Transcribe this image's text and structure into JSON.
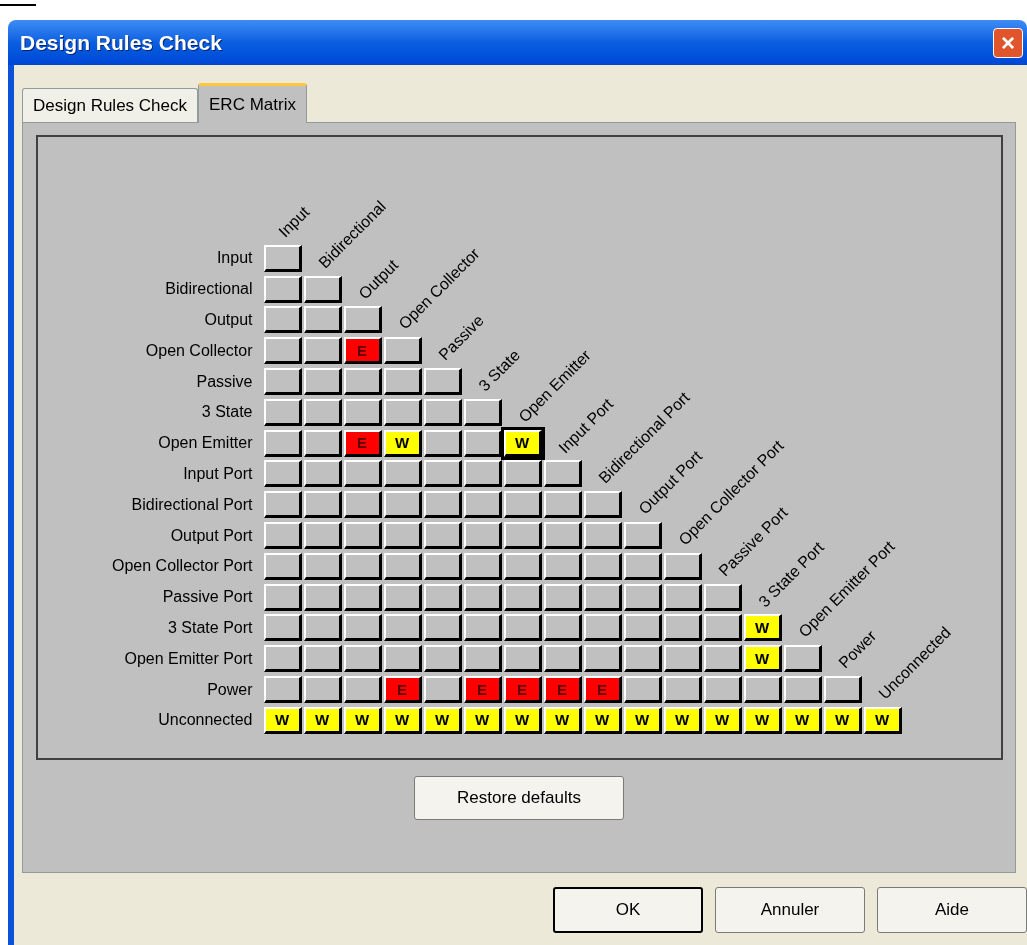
{
  "window": {
    "title": "Design Rules Check",
    "close": "×"
  },
  "tabs": [
    {
      "label": "Design Rules Check",
      "selected": false
    },
    {
      "label": "ERC Matrix",
      "selected": true
    }
  ],
  "matrix": {
    "pin_types": [
      {
        "label": "Input",
        "cells": [
          {
            "kind": "none",
            "selected": false
          }
        ]
      },
      {
        "label": "Bidirectional",
        "cells": [
          {
            "kind": "none",
            "selected": false
          },
          {
            "kind": "none",
            "selected": false
          }
        ]
      },
      {
        "label": "Output",
        "cells": [
          {
            "kind": "none",
            "selected": false
          },
          {
            "kind": "none",
            "selected": false
          },
          {
            "kind": "none",
            "selected": false
          }
        ]
      },
      {
        "label": "Open Collector",
        "cells": [
          {
            "kind": "none",
            "selected": false
          },
          {
            "kind": "none",
            "selected": false
          },
          {
            "kind": "error",
            "text": "E",
            "selected": false
          },
          {
            "kind": "none",
            "selected": false
          }
        ]
      },
      {
        "label": "Passive",
        "cells": [
          {
            "kind": "none",
            "selected": false
          },
          {
            "kind": "none",
            "selected": false
          },
          {
            "kind": "none",
            "selected": false
          },
          {
            "kind": "none",
            "selected": false
          },
          {
            "kind": "none",
            "selected": false
          }
        ]
      },
      {
        "label": "3 State",
        "cells": [
          {
            "kind": "none",
            "selected": false
          },
          {
            "kind": "none",
            "selected": false
          },
          {
            "kind": "none",
            "selected": false
          },
          {
            "kind": "none",
            "selected": false
          },
          {
            "kind": "none",
            "selected": false
          },
          {
            "kind": "none",
            "selected": false
          }
        ]
      },
      {
        "label": "Open Emitter",
        "cells": [
          {
            "kind": "none",
            "selected": false
          },
          {
            "kind": "none",
            "selected": false
          },
          {
            "kind": "error",
            "text": "E",
            "selected": false
          },
          {
            "kind": "warning",
            "text": "W",
            "selected": false
          },
          {
            "kind": "none",
            "selected": false
          },
          {
            "kind": "none",
            "selected": false
          },
          {
            "kind": "warning",
            "text": "W",
            "selected": true
          }
        ]
      },
      {
        "label": "Input Port",
        "cells": [
          {
            "kind": "none",
            "selected": false
          },
          {
            "kind": "none",
            "selected": false
          },
          {
            "kind": "none",
            "selected": false
          },
          {
            "kind": "none",
            "selected": false
          },
          {
            "kind": "none",
            "selected": false
          },
          {
            "kind": "none",
            "selected": false
          },
          {
            "kind": "none",
            "selected": false
          },
          {
            "kind": "none",
            "selected": false
          }
        ]
      },
      {
        "label": "Bidirectional Port",
        "cells": [
          {
            "kind": "none",
            "selected": false
          },
          {
            "kind": "none",
            "selected": false
          },
          {
            "kind": "none",
            "selected": false
          },
          {
            "kind": "none",
            "selected": false
          },
          {
            "kind": "none",
            "selected": false
          },
          {
            "kind": "none",
            "selected": false
          },
          {
            "kind": "none",
            "selected": false
          },
          {
            "kind": "none",
            "selected": false
          },
          {
            "kind": "none",
            "selected": false
          }
        ]
      },
      {
        "label": "Output Port",
        "cells": [
          {
            "kind": "none",
            "selected": false
          },
          {
            "kind": "none",
            "selected": false
          },
          {
            "kind": "none",
            "selected": false
          },
          {
            "kind": "none",
            "selected": false
          },
          {
            "kind": "none",
            "selected": false
          },
          {
            "kind": "none",
            "selected": false
          },
          {
            "kind": "none",
            "selected": false
          },
          {
            "kind": "none",
            "selected": false
          },
          {
            "kind": "none",
            "selected": false
          },
          {
            "kind": "none",
            "selected": false
          }
        ]
      },
      {
        "label": "Open Collector Port",
        "cells": [
          {
            "kind": "none",
            "selected": false
          },
          {
            "kind": "none",
            "selected": false
          },
          {
            "kind": "none",
            "selected": false
          },
          {
            "kind": "none",
            "selected": false
          },
          {
            "kind": "none",
            "selected": false
          },
          {
            "kind": "none",
            "selected": false
          },
          {
            "kind": "none",
            "selected": false
          },
          {
            "kind": "none",
            "selected": false
          },
          {
            "kind": "none",
            "selected": false
          },
          {
            "kind": "none",
            "selected": false
          },
          {
            "kind": "none",
            "selected": false
          }
        ]
      },
      {
        "label": "Passive Port",
        "cells": [
          {
            "kind": "none",
            "selected": false
          },
          {
            "kind": "none",
            "selected": false
          },
          {
            "kind": "none",
            "selected": false
          },
          {
            "kind": "none",
            "selected": false
          },
          {
            "kind": "none",
            "selected": false
          },
          {
            "kind": "none",
            "selected": false
          },
          {
            "kind": "none",
            "selected": false
          },
          {
            "kind": "none",
            "selected": false
          },
          {
            "kind": "none",
            "selected": false
          },
          {
            "kind": "none",
            "selected": false
          },
          {
            "kind": "none",
            "selected": false
          },
          {
            "kind": "none",
            "selected": false
          }
        ]
      },
      {
        "label": "3 State Port",
        "cells": [
          {
            "kind": "none",
            "selected": false
          },
          {
            "kind": "none",
            "selected": false
          },
          {
            "kind": "none",
            "selected": false
          },
          {
            "kind": "none",
            "selected": false
          },
          {
            "kind": "none",
            "selected": false
          },
          {
            "kind": "none",
            "selected": false
          },
          {
            "kind": "none",
            "selected": false
          },
          {
            "kind": "none",
            "selected": false
          },
          {
            "kind": "none",
            "selected": false
          },
          {
            "kind": "none",
            "selected": false
          },
          {
            "kind": "none",
            "selected": false
          },
          {
            "kind": "none",
            "selected": false
          },
          {
            "kind": "warning",
            "text": "W",
            "selected": false
          }
        ]
      },
      {
        "label": "Open Emitter Port",
        "cells": [
          {
            "kind": "none",
            "selected": false
          },
          {
            "kind": "none",
            "selected": false
          },
          {
            "kind": "none",
            "selected": false
          },
          {
            "kind": "none",
            "selected": false
          },
          {
            "kind": "none",
            "selected": false
          },
          {
            "kind": "none",
            "selected": false
          },
          {
            "kind": "none",
            "selected": false
          },
          {
            "kind": "none",
            "selected": false
          },
          {
            "kind": "none",
            "selected": false
          },
          {
            "kind": "none",
            "selected": false
          },
          {
            "kind": "none",
            "selected": false
          },
          {
            "kind": "none",
            "selected": false
          },
          {
            "kind": "warning",
            "text": "W",
            "selected": false
          },
          {
            "kind": "none",
            "selected": false
          }
        ]
      },
      {
        "label": "Power",
        "cells": [
          {
            "kind": "none",
            "selected": false
          },
          {
            "kind": "none",
            "selected": false
          },
          {
            "kind": "none",
            "selected": false
          },
          {
            "kind": "error",
            "text": "E",
            "selected": false
          },
          {
            "kind": "none",
            "selected": false
          },
          {
            "kind": "error",
            "text": "E",
            "selected": false
          },
          {
            "kind": "error",
            "text": "E",
            "selected": false
          },
          {
            "kind": "error",
            "text": "E",
            "selected": false
          },
          {
            "kind": "error",
            "text": "E",
            "selected": false
          },
          {
            "kind": "none",
            "selected": false
          },
          {
            "kind": "none",
            "selected": false
          },
          {
            "kind": "none",
            "selected": false
          },
          {
            "kind": "none",
            "selected": false
          },
          {
            "kind": "none",
            "selected": false
          },
          {
            "kind": "none",
            "selected": false
          }
        ]
      },
      {
        "label": "Unconnected",
        "cells": [
          {
            "kind": "warning",
            "text": "W",
            "selected": false
          },
          {
            "kind": "warning",
            "text": "W",
            "selected": false
          },
          {
            "kind": "warning",
            "text": "W",
            "selected": false
          },
          {
            "kind": "warning",
            "text": "W",
            "selected": false
          },
          {
            "kind": "warning",
            "text": "W",
            "selected": false
          },
          {
            "kind": "warning",
            "text": "W",
            "selected": false
          },
          {
            "kind": "warning",
            "text": "W",
            "selected": false
          },
          {
            "kind": "warning",
            "text": "W",
            "selected": false
          },
          {
            "kind": "warning",
            "text": "W",
            "selected": false
          },
          {
            "kind": "warning",
            "text": "W",
            "selected": false
          },
          {
            "kind": "warning",
            "text": "W",
            "selected": false
          },
          {
            "kind": "warning",
            "text": "W",
            "selected": false
          },
          {
            "kind": "warning",
            "text": "W",
            "selected": false
          },
          {
            "kind": "warning",
            "text": "W",
            "selected": false
          },
          {
            "kind": "warning",
            "text": "W",
            "selected": false
          },
          {
            "kind": "warning",
            "text": "W",
            "selected": false
          }
        ]
      }
    ],
    "columns": [
      "Input",
      "Bidirectional",
      "Output",
      "Open Collector",
      "Passive",
      "3 State",
      "Open Emitter",
      "Input Port",
      "Bidirectional Port",
      "Output Port",
      "Open Collector Port",
      "Passive Port",
      "3 State Port",
      "Open Emitter Port",
      "Power",
      "Unconnected"
    ]
  },
  "restore_button": "Restore defaults",
  "buttons": [
    "OK",
    "Annuler",
    "Aide"
  ]
}
